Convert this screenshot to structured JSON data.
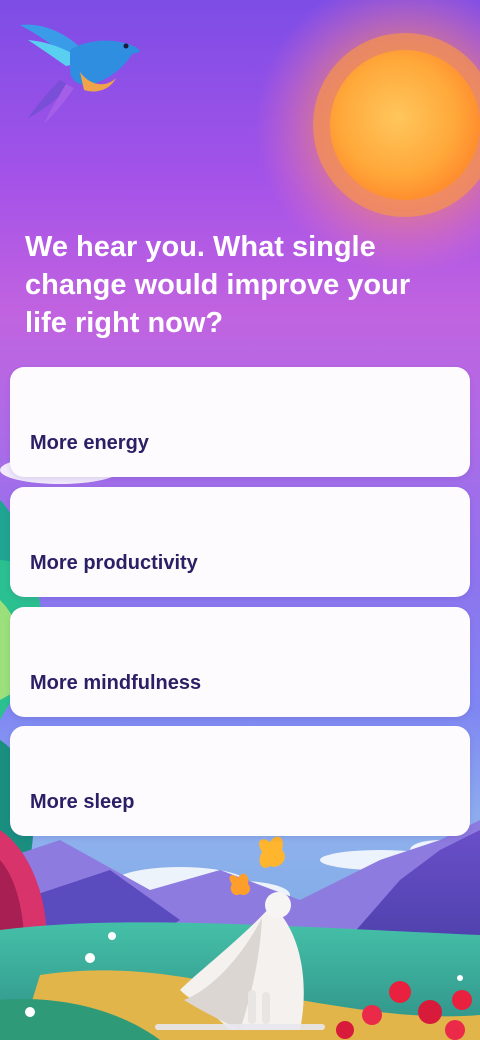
{
  "question": {
    "line1": "We hear you. What single",
    "line2": "change would improve your",
    "line3": "life right now?"
  },
  "options": [
    {
      "label": "More energy"
    },
    {
      "label": "More productivity"
    },
    {
      "label": "More mindfulness"
    },
    {
      "label": "More sleep"
    }
  ],
  "colors": {
    "card_background": "#fdfbfd",
    "option_text": "#2d1f66",
    "question_text": "#ffffff"
  }
}
